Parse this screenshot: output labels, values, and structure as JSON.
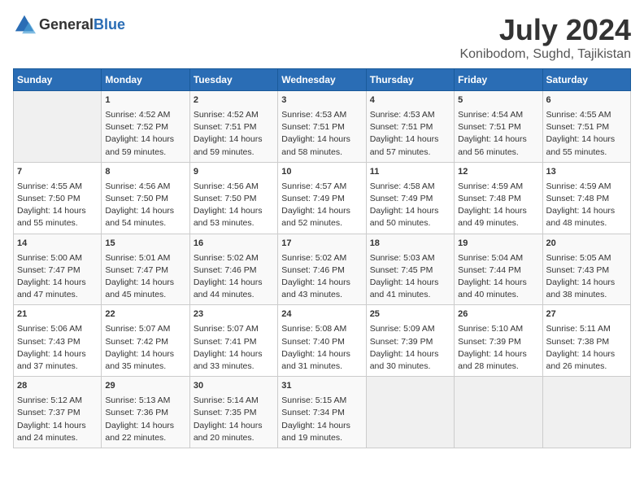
{
  "logo": {
    "text_general": "General",
    "text_blue": "Blue"
  },
  "title": "July 2024",
  "subtitle": "Konibodom, Sughd, Tajikistan",
  "headers": [
    "Sunday",
    "Monday",
    "Tuesday",
    "Wednesday",
    "Thursday",
    "Friday",
    "Saturday"
  ],
  "weeks": [
    [
      {
        "num": "",
        "content": ""
      },
      {
        "num": "1",
        "content": "Sunrise: 4:52 AM\nSunset: 7:52 PM\nDaylight: 14 hours\nand 59 minutes."
      },
      {
        "num": "2",
        "content": "Sunrise: 4:52 AM\nSunset: 7:51 PM\nDaylight: 14 hours\nand 59 minutes."
      },
      {
        "num": "3",
        "content": "Sunrise: 4:53 AM\nSunset: 7:51 PM\nDaylight: 14 hours\nand 58 minutes."
      },
      {
        "num": "4",
        "content": "Sunrise: 4:53 AM\nSunset: 7:51 PM\nDaylight: 14 hours\nand 57 minutes."
      },
      {
        "num": "5",
        "content": "Sunrise: 4:54 AM\nSunset: 7:51 PM\nDaylight: 14 hours\nand 56 minutes."
      },
      {
        "num": "6",
        "content": "Sunrise: 4:55 AM\nSunset: 7:51 PM\nDaylight: 14 hours\nand 55 minutes."
      }
    ],
    [
      {
        "num": "7",
        "content": "Sunrise: 4:55 AM\nSunset: 7:50 PM\nDaylight: 14 hours\nand 55 minutes."
      },
      {
        "num": "8",
        "content": "Sunrise: 4:56 AM\nSunset: 7:50 PM\nDaylight: 14 hours\nand 54 minutes."
      },
      {
        "num": "9",
        "content": "Sunrise: 4:56 AM\nSunset: 7:50 PM\nDaylight: 14 hours\nand 53 minutes."
      },
      {
        "num": "10",
        "content": "Sunrise: 4:57 AM\nSunset: 7:49 PM\nDaylight: 14 hours\nand 52 minutes."
      },
      {
        "num": "11",
        "content": "Sunrise: 4:58 AM\nSunset: 7:49 PM\nDaylight: 14 hours\nand 50 minutes."
      },
      {
        "num": "12",
        "content": "Sunrise: 4:59 AM\nSunset: 7:48 PM\nDaylight: 14 hours\nand 49 minutes."
      },
      {
        "num": "13",
        "content": "Sunrise: 4:59 AM\nSunset: 7:48 PM\nDaylight: 14 hours\nand 48 minutes."
      }
    ],
    [
      {
        "num": "14",
        "content": "Sunrise: 5:00 AM\nSunset: 7:47 PM\nDaylight: 14 hours\nand 47 minutes."
      },
      {
        "num": "15",
        "content": "Sunrise: 5:01 AM\nSunset: 7:47 PM\nDaylight: 14 hours\nand 45 minutes."
      },
      {
        "num": "16",
        "content": "Sunrise: 5:02 AM\nSunset: 7:46 PM\nDaylight: 14 hours\nand 44 minutes."
      },
      {
        "num": "17",
        "content": "Sunrise: 5:02 AM\nSunset: 7:46 PM\nDaylight: 14 hours\nand 43 minutes."
      },
      {
        "num": "18",
        "content": "Sunrise: 5:03 AM\nSunset: 7:45 PM\nDaylight: 14 hours\nand 41 minutes."
      },
      {
        "num": "19",
        "content": "Sunrise: 5:04 AM\nSunset: 7:44 PM\nDaylight: 14 hours\nand 40 minutes."
      },
      {
        "num": "20",
        "content": "Sunrise: 5:05 AM\nSunset: 7:43 PM\nDaylight: 14 hours\nand 38 minutes."
      }
    ],
    [
      {
        "num": "21",
        "content": "Sunrise: 5:06 AM\nSunset: 7:43 PM\nDaylight: 14 hours\nand 37 minutes."
      },
      {
        "num": "22",
        "content": "Sunrise: 5:07 AM\nSunset: 7:42 PM\nDaylight: 14 hours\nand 35 minutes."
      },
      {
        "num": "23",
        "content": "Sunrise: 5:07 AM\nSunset: 7:41 PM\nDaylight: 14 hours\nand 33 minutes."
      },
      {
        "num": "24",
        "content": "Sunrise: 5:08 AM\nSunset: 7:40 PM\nDaylight: 14 hours\nand 31 minutes."
      },
      {
        "num": "25",
        "content": "Sunrise: 5:09 AM\nSunset: 7:39 PM\nDaylight: 14 hours\nand 30 minutes."
      },
      {
        "num": "26",
        "content": "Sunrise: 5:10 AM\nSunset: 7:39 PM\nDaylight: 14 hours\nand 28 minutes."
      },
      {
        "num": "27",
        "content": "Sunrise: 5:11 AM\nSunset: 7:38 PM\nDaylight: 14 hours\nand 26 minutes."
      }
    ],
    [
      {
        "num": "28",
        "content": "Sunrise: 5:12 AM\nSunset: 7:37 PM\nDaylight: 14 hours\nand 24 minutes."
      },
      {
        "num": "29",
        "content": "Sunrise: 5:13 AM\nSunset: 7:36 PM\nDaylight: 14 hours\nand 22 minutes."
      },
      {
        "num": "30",
        "content": "Sunrise: 5:14 AM\nSunset: 7:35 PM\nDaylight: 14 hours\nand 20 minutes."
      },
      {
        "num": "31",
        "content": "Sunrise: 5:15 AM\nSunset: 7:34 PM\nDaylight: 14 hours\nand 19 minutes."
      },
      {
        "num": "",
        "content": ""
      },
      {
        "num": "",
        "content": ""
      },
      {
        "num": "",
        "content": ""
      }
    ]
  ]
}
